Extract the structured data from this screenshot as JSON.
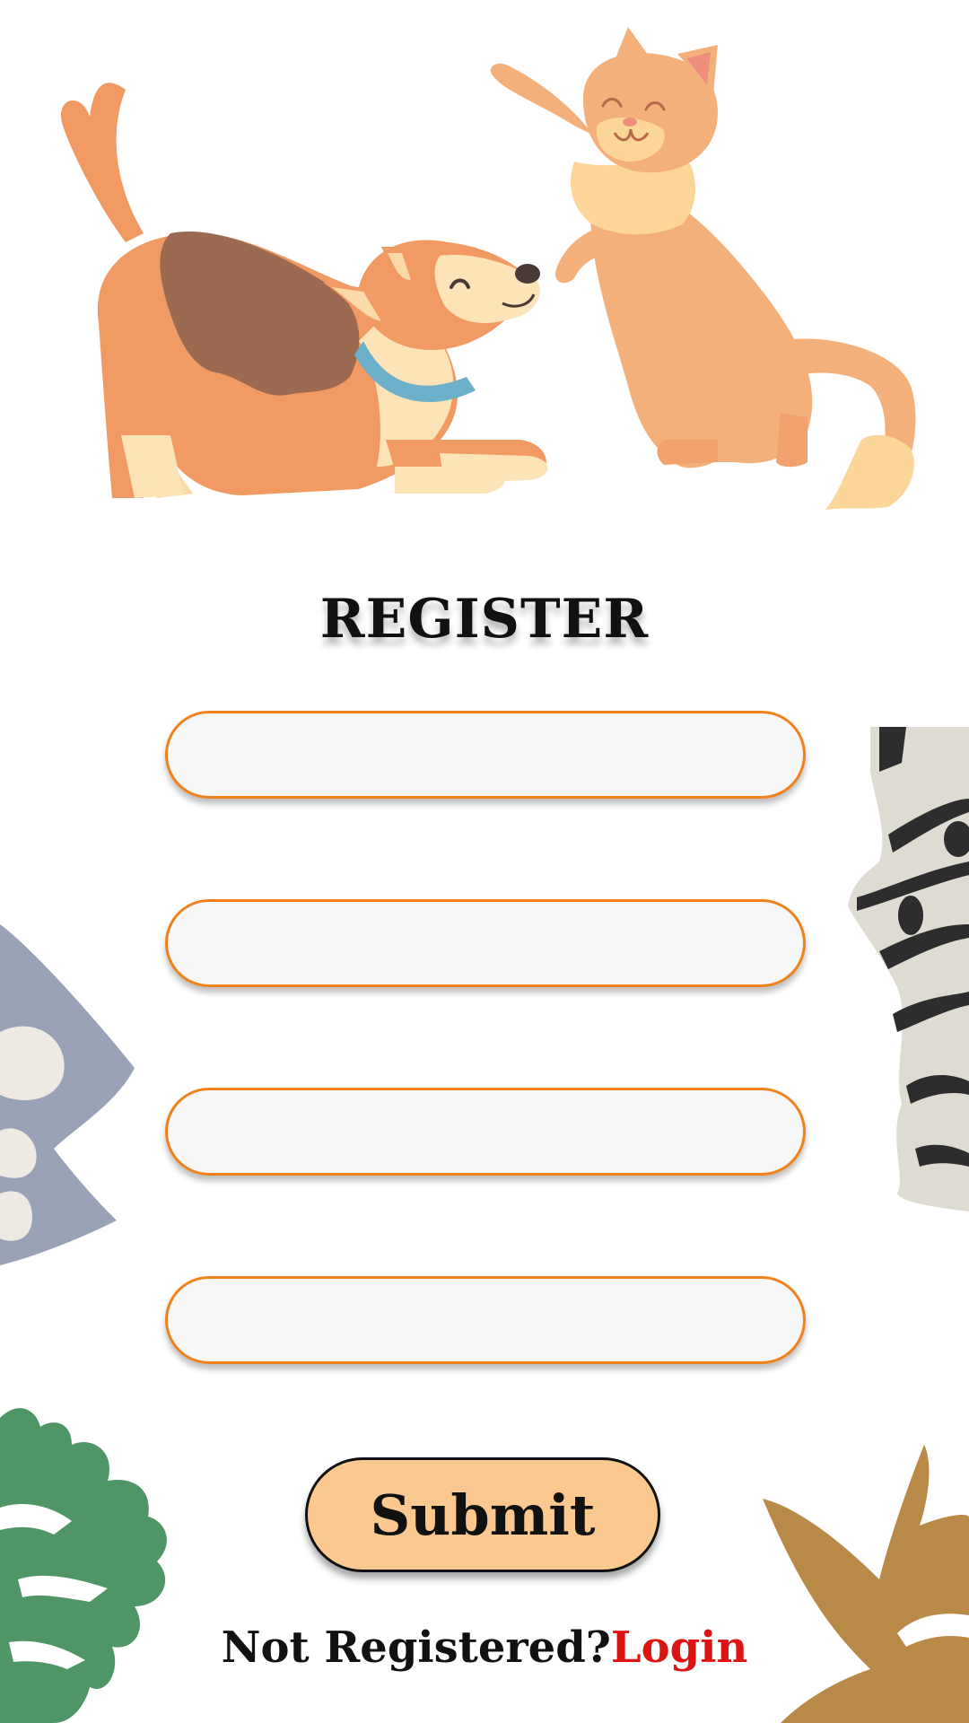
{
  "screen": {
    "title": "REGISTER"
  },
  "form": {
    "fields": [
      {
        "value": "",
        "placeholder": ""
      },
      {
        "value": "",
        "placeholder": ""
      },
      {
        "value": "",
        "placeholder": ""
      },
      {
        "value": "",
        "placeholder": ""
      }
    ],
    "submit_label": "Submit"
  },
  "footer": {
    "prompt": "Not Registered?",
    "link_label": "Login"
  },
  "illustrations": {
    "hero": "dog-and-cat-playing-illustration",
    "left_middle": "blue-abstract-leaf-shape",
    "right_middle": "zebra-print-torn-paper",
    "bottom_left": "green-monstera-leaf",
    "bottom_right": "brown-starfish-shape"
  },
  "colors": {
    "accent": "#f0821e",
    "button_fill": "#fbc98f",
    "link": "#dc1414",
    "text": "#111111"
  }
}
